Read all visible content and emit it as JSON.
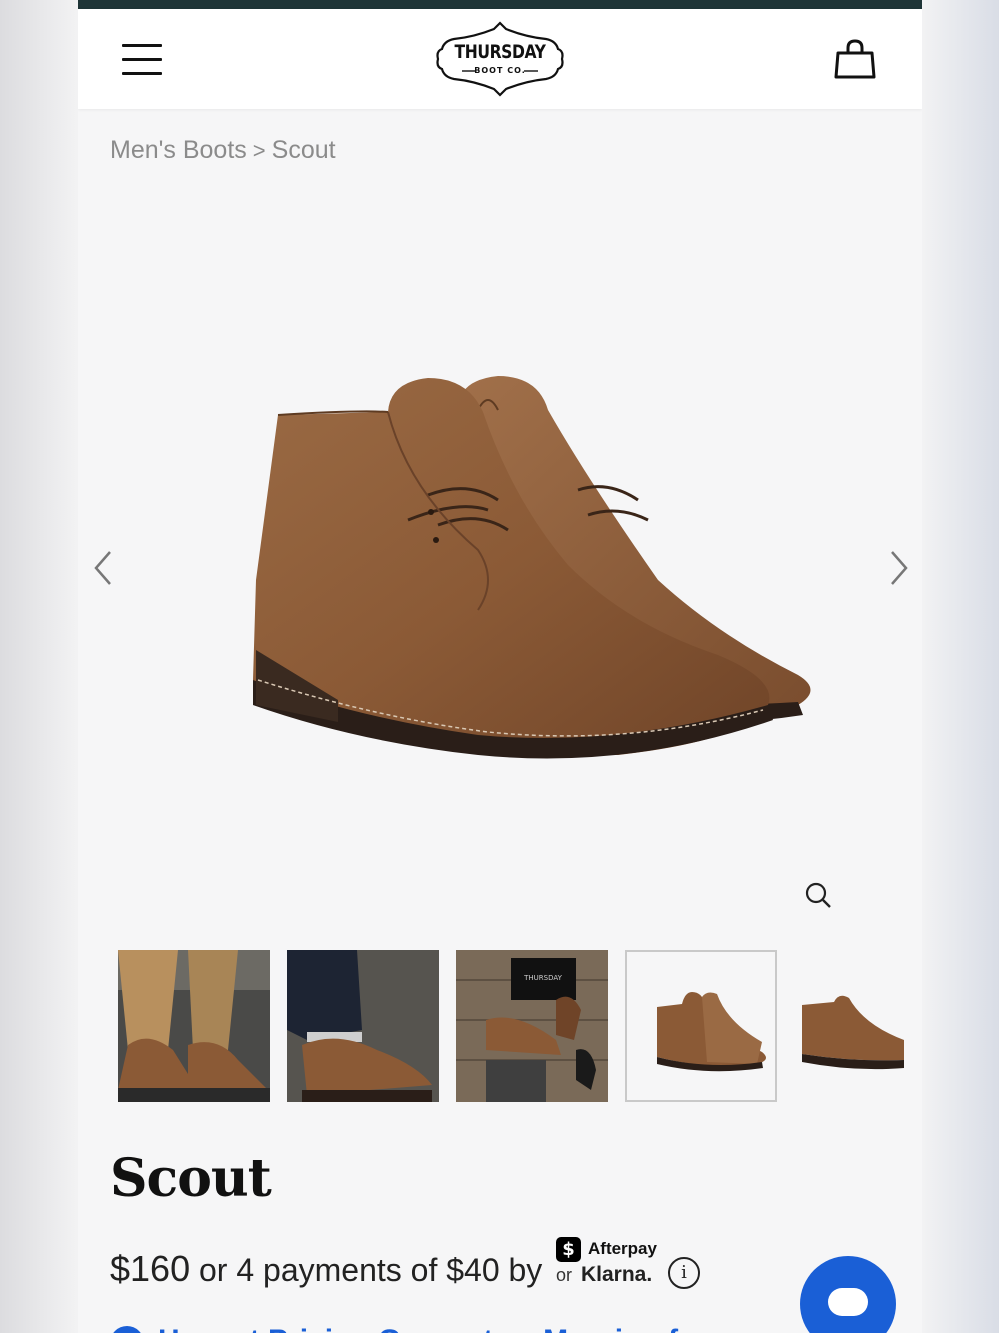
{
  "header": {
    "logo_main": "THURSDAY",
    "logo_sub": "BOOT CO.",
    "menu_icon": "hamburger-icon",
    "cart_icon": "shopping-bag-icon"
  },
  "breadcrumb": {
    "items": [
      "Men's Boots",
      "Scout"
    ],
    "separator": ">"
  },
  "gallery": {
    "prev_icon": "chevron-left-icon",
    "next_icon": "chevron-right-icon",
    "zoom_icon": "magnifier-icon",
    "thumbnail_count_visible": 5,
    "active_thumbnail": 4,
    "box_text": "THURSDAY"
  },
  "product": {
    "title": "Scout",
    "price": "$160",
    "installment_text": "or 4 payments of $40 by",
    "afterpay_symbol": "$",
    "afterpay_label": "Afterpay",
    "or_label": "or",
    "klarna_label": "Klarna.",
    "info_glyph": "i"
  },
  "next_section": {
    "text": "Honest Pricing Guarantee. Margin of..."
  },
  "colors": {
    "topbar": "#1f3537",
    "accent_blue": "#1a5fd6",
    "suede": "#8b5a36"
  }
}
